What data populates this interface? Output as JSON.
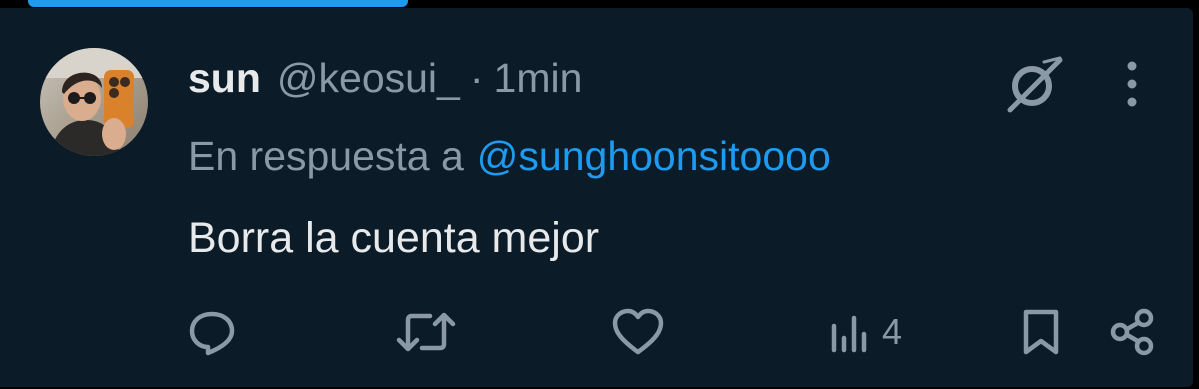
{
  "tweet": {
    "display_name": "sun",
    "handle": "@keosui_",
    "separator": "·",
    "time": "1min",
    "reply_prefix": "En respuesta a",
    "reply_to": "@sunghoonsitoooo",
    "text": "Borra la cuenta mejor"
  },
  "actions": {
    "views_count": "4"
  },
  "icons": {
    "grok": "grok-icon",
    "more": "more-vertical-icon",
    "reply": "comment-bubble-icon",
    "retweet": "retweet-icon",
    "like": "heart-icon",
    "views": "bar-chart-icon",
    "bookmark": "bookmark-icon",
    "share": "share-icon"
  },
  "colors": {
    "background": "#0b1b27",
    "primary_text": "#e7e9ea",
    "secondary_text": "#8b98a5",
    "accent": "#1d9bf0"
  }
}
